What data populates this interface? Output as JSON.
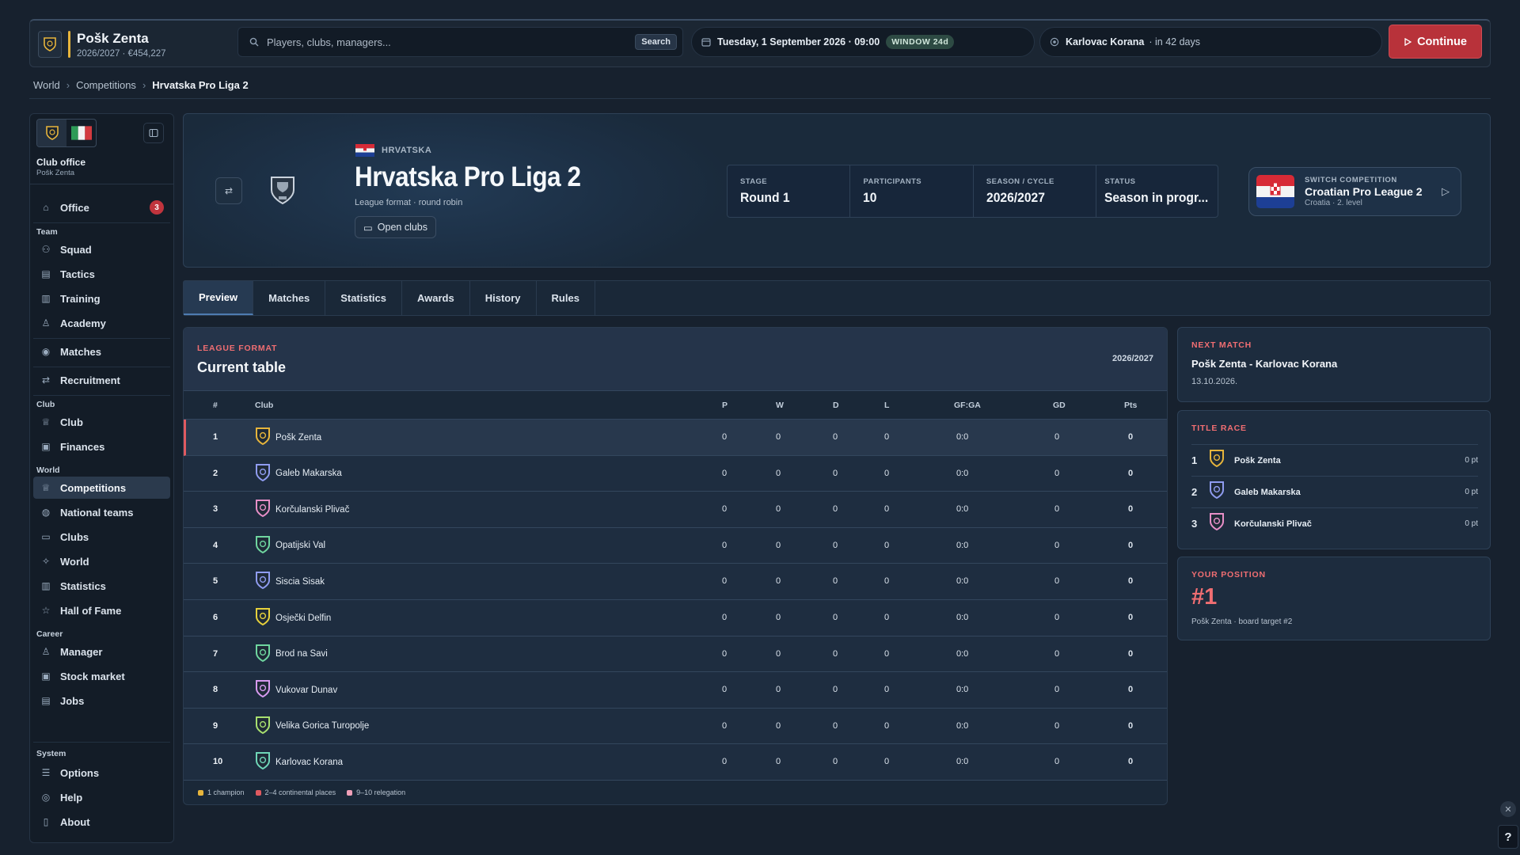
{
  "app": {
    "club_name": "Pošk Zenta",
    "club_sub": "2026/2027 · €454,227",
    "search_placeholder": "Players, clubs, managers...",
    "search_button": "Search",
    "date": "Tuesday, 1 September 2026 · 09:00",
    "window_badge": "WINDOW 24d",
    "next_opponent": "Karlovac Korana",
    "next_in": "· in 42 days",
    "continue_label": "Continue"
  },
  "breadcrumb": [
    "World",
    "Competitions",
    "Hrvatska Pro Liga 2"
  ],
  "sidebar": {
    "office_title": "Club office",
    "office_sub": "Pošk Zenta",
    "office_badge": "3",
    "groups": {
      "team": "Team",
      "club": "Club",
      "world": "World",
      "career": "Career",
      "system": "System"
    },
    "items": [
      "Office",
      "Squad",
      "Tactics",
      "Training",
      "Academy",
      "Matches",
      "Recruitment",
      "Club",
      "Finances",
      "Competitions",
      "National teams",
      "Clubs",
      "World",
      "Statistics",
      "Hall of Fame",
      "Manager",
      "Stock market",
      "Jobs",
      "Options",
      "Help",
      "About"
    ]
  },
  "hero": {
    "country": "HRVATSKA",
    "title": "Hrvatska Pro Liga 2",
    "format": "League format · round robin",
    "open_clubs": "Open clubs",
    "stats": [
      {
        "label": "STAGE",
        "value": "Round 1"
      },
      {
        "label": "PARTICIPANTS",
        "value": "10"
      },
      {
        "label": "SEASON / CYCLE",
        "value": "2026/2027"
      },
      {
        "label": "STATUS",
        "value": "Season in progr..."
      }
    ],
    "switch_label": "SWITCH COMPETITION",
    "switch_name": "Croatian Pro League 2",
    "switch_sub": "Croatia · 2. level"
  },
  "tabs": [
    "Preview",
    "Matches",
    "Statistics",
    "Awards",
    "History",
    "Rules"
  ],
  "table": {
    "kicker": "LEAGUE FORMAT",
    "title": "Current table",
    "season": "2026/2027",
    "headers": [
      "#",
      "Club",
      "P",
      "W",
      "D",
      "L",
      "GF:GA",
      "GD",
      "Pts"
    ],
    "rows": [
      {
        "pos": "1",
        "club": "Pošk Zenta",
        "p": "0",
        "w": "0",
        "d": "0",
        "l": "0",
        "gfga": "0:0",
        "gd": "0",
        "pts": "0",
        "crest": "#e7b53c"
      },
      {
        "pos": "2",
        "club": "Galeb Makarska",
        "p": "0",
        "w": "0",
        "d": "0",
        "l": "0",
        "gfga": "0:0",
        "gd": "0",
        "pts": "0",
        "crest": "#8f9cf0"
      },
      {
        "pos": "3",
        "club": "Korčulanski Plivač",
        "p": "0",
        "w": "0",
        "d": "0",
        "l": "0",
        "gfga": "0:0",
        "gd": "0",
        "pts": "0",
        "crest": "#e78fc8"
      },
      {
        "pos": "4",
        "club": "Opatijski Val",
        "p": "0",
        "w": "0",
        "d": "0",
        "l": "0",
        "gfga": "0:0",
        "gd": "0",
        "pts": "0",
        "crest": "#6fd6a0"
      },
      {
        "pos": "5",
        "club": "Siscia Sisak",
        "p": "0",
        "w": "0",
        "d": "0",
        "l": "0",
        "gfga": "0:0",
        "gd": "0",
        "pts": "0",
        "crest": "#8f9cf0"
      },
      {
        "pos": "6",
        "club": "Osječki Delfin",
        "p": "0",
        "w": "0",
        "d": "0",
        "l": "0",
        "gfga": "0:0",
        "gd": "0",
        "pts": "0",
        "crest": "#e7d13c"
      },
      {
        "pos": "7",
        "club": "Brod na Savi",
        "p": "0",
        "w": "0",
        "d": "0",
        "l": "0",
        "gfga": "0:0",
        "gd": "0",
        "pts": "0",
        "crest": "#6fd6a0"
      },
      {
        "pos": "8",
        "club": "Vukovar Dunav",
        "p": "0",
        "w": "0",
        "d": "0",
        "l": "0",
        "gfga": "0:0",
        "gd": "0",
        "pts": "0",
        "crest": "#d79af0"
      },
      {
        "pos": "9",
        "club": "Velika Gorica Turopolje",
        "p": "0",
        "w": "0",
        "d": "0",
        "l": "0",
        "gfga": "0:0",
        "gd": "0",
        "pts": "0",
        "crest": "#a8e070"
      },
      {
        "pos": "10",
        "club": "Karlovac Korana",
        "p": "0",
        "w": "0",
        "d": "0",
        "l": "0",
        "gfga": "0:0",
        "gd": "0",
        "pts": "0",
        "crest": "#6fd6b8"
      }
    ],
    "legend": [
      "1 champion",
      "2–4 continental places",
      "9–10 relegation"
    ]
  },
  "next_match": {
    "kicker": "NEXT MATCH",
    "match": "Pošk Zenta - Karlovac Korana",
    "date": "13.10.2026."
  },
  "title_race": {
    "kicker": "TITLE RACE",
    "rows": [
      {
        "rank": "1",
        "club": "Pošk Zenta",
        "pts": "0 pt",
        "crest": "#e7b53c"
      },
      {
        "rank": "2",
        "club": "Galeb Makarska",
        "pts": "0 pt",
        "crest": "#8f9cf0"
      },
      {
        "rank": "3",
        "club": "Korčulanski Plivač",
        "pts": "0 pt",
        "crest": "#e78fc8"
      }
    ]
  },
  "your_position": {
    "kicker": "YOUR POSITION",
    "value": "#1",
    "sub": "Pošk Zenta · board target #2"
  },
  "colors": {
    "accent": "#f06e72",
    "continue": "#b8323a",
    "champion": "#e7b53c",
    "continental": "#e05a60",
    "relegation": "#f0a0b8"
  },
  "help_label": "?"
}
